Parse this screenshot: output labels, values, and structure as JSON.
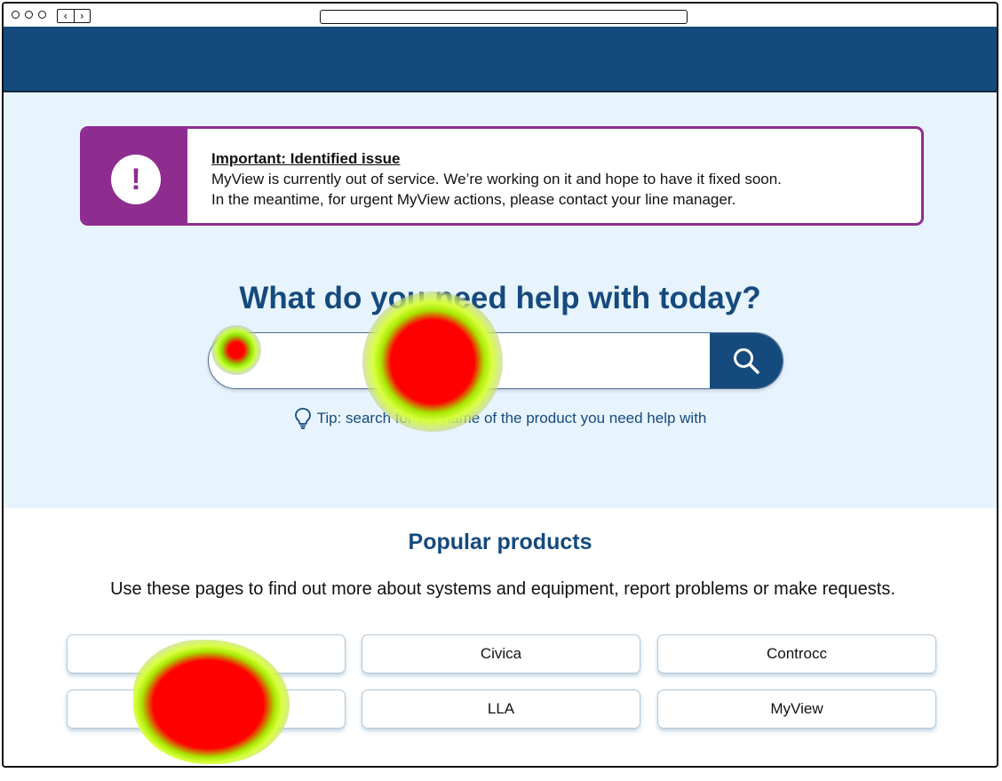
{
  "alert": {
    "icon": "exclamation-icon",
    "icon_glyph": "!",
    "title": "Important: Identified issue",
    "line1": "MyView is currently out of service. We’re working on it and hope to have it fixed soon.",
    "line2": "In the meantime, for urgent MyView actions, please contact your line manager."
  },
  "hero": {
    "headline": "What do you need help with today?",
    "search_placeholder": "",
    "tip": "Tip: search for the name of the product you need help with"
  },
  "popular": {
    "title": "Popular products",
    "description": "Use these pages to find out more about systems and equipment, report problems or make requests.",
    "products": [
      "Outlook",
      "Civica",
      "Controcc",
      "",
      "LLA",
      "MyView"
    ]
  },
  "colors": {
    "brand": "#154a7d",
    "alert": "#8e2d8f",
    "hero_bg": "#e8f4fd"
  }
}
